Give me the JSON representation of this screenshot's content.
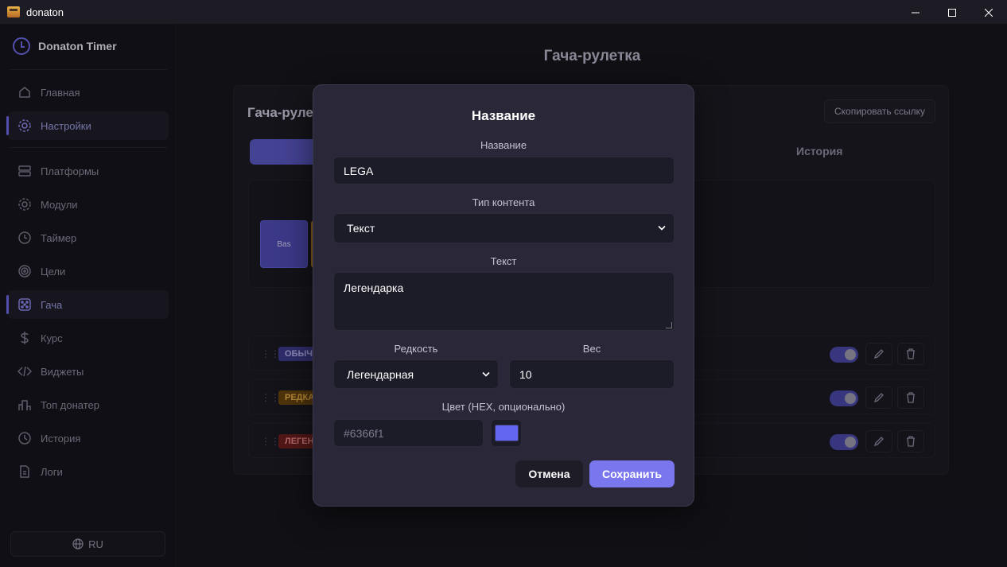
{
  "window": {
    "title": "donaton"
  },
  "sidebar": {
    "brand": "Donaton Timer",
    "items": [
      {
        "label": "Главная",
        "icon": "home-icon"
      },
      {
        "label": "Настройки",
        "icon": "gear-icon",
        "active": true
      },
      {
        "label": "Платформы",
        "icon": "server-icon"
      },
      {
        "label": "Модули",
        "icon": "gear-icon"
      },
      {
        "label": "Таймер",
        "icon": "clock-icon"
      },
      {
        "label": "Цели",
        "icon": "target-icon"
      },
      {
        "label": "Гача",
        "icon": "dice-icon",
        "active": true
      },
      {
        "label": "Курс",
        "icon": "dollar-icon"
      },
      {
        "label": "Виджеты",
        "icon": "code-icon"
      },
      {
        "label": "Топ донатер",
        "icon": "podium-icon"
      },
      {
        "label": "История",
        "icon": "history-icon"
      },
      {
        "label": "Логи",
        "icon": "file-icon"
      }
    ],
    "language": "RU"
  },
  "main": {
    "page_title": "Гача-рулетка",
    "card_title": "Гача-руле",
    "copy_link_label": "Скопировать ссылку",
    "tab_history": "История",
    "preview_box_label": "Bas",
    "rows": [
      {
        "tag": "ОБЫЧ",
        "tag_color": "#4f4cb6",
        "tag_text_color": "#b9b7f5"
      },
      {
        "tag": "РЕДКА",
        "tag_color": "#8a5a12",
        "tag_text_color": "#f0b54a"
      },
      {
        "tag": "ЛЕГЕН",
        "tag_color": "#8a2424",
        "tag_text_color": "#f08a8a"
      }
    ]
  },
  "modal": {
    "title": "Название",
    "name_label": "Название",
    "name_value": "LEGA",
    "content_type_label": "Тип контента",
    "content_type_value": "Текст",
    "text_label": "Текст",
    "text_value": "Легендарка",
    "rarity_label": "Редкость",
    "rarity_value": "Легендарная",
    "weight_label": "Вес",
    "weight_value": "10",
    "color_label": "Цвет (HEX, опционально)",
    "color_placeholder": "#6366f1",
    "color_swatch": "#6366f1",
    "cancel_label": "Отмена",
    "save_label": "Сохранить"
  },
  "colors": {
    "accent": "#7a76ee",
    "active_tab": "#5b58c4"
  }
}
